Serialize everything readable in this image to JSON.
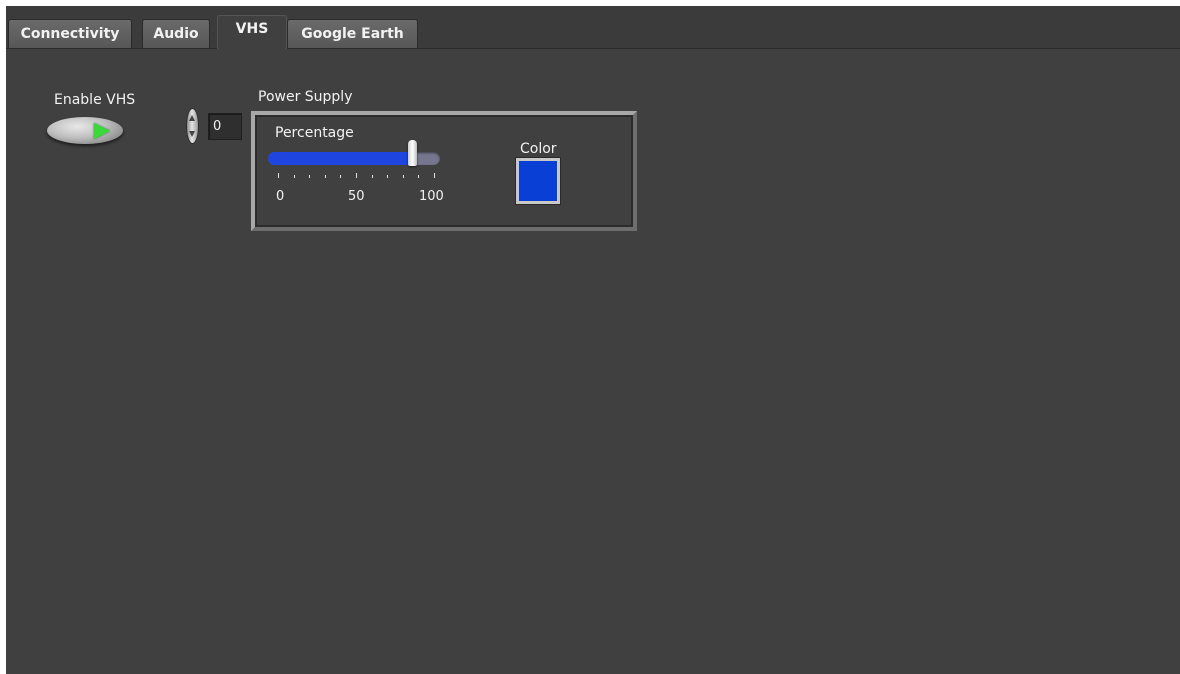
{
  "tabs": [
    {
      "label": "Connectivity",
      "active": false
    },
    {
      "label": "Audio",
      "active": false
    },
    {
      "label": "VHS",
      "active": true
    },
    {
      "label": "Google Earth",
      "active": false
    }
  ],
  "enable_vhs": {
    "label": "Enable VHS",
    "state": "on",
    "indicator_color": "#39d93a"
  },
  "index_control": {
    "value": "0"
  },
  "power_supply": {
    "label": "Power Supply",
    "percentage": {
      "label": "Percentage",
      "value_percent": 90,
      "scale_labels": [
        "0",
        "50",
        "100"
      ],
      "fill_color": "#1f45e0"
    },
    "color": {
      "label": "Color",
      "value": "#0a3fd6"
    }
  },
  "colors": {
    "panel_bg": "#404040",
    "text": "#f2f2f2"
  }
}
